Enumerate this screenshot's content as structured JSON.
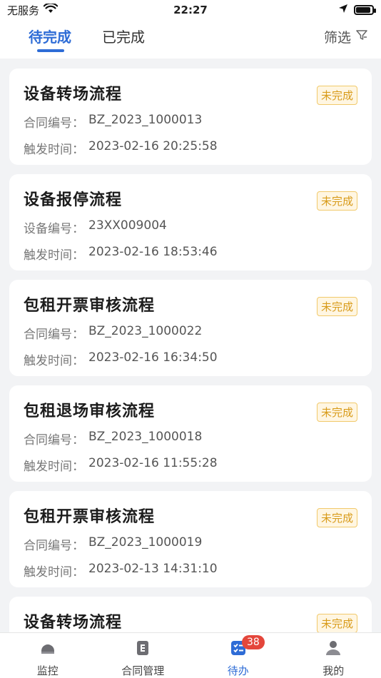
{
  "status_bar": {
    "carrier": "无服务",
    "time": "22:27",
    "battery_level": 0.9
  },
  "tabs": [
    {
      "label": "待完成",
      "active": true
    },
    {
      "label": "已完成",
      "active": false
    }
  ],
  "filter": {
    "label": "筛选",
    "icon": "filter-icon"
  },
  "cards": [
    {
      "title": "设备转场流程",
      "row1_label": "合同编号：",
      "row1_value": "BZ_2023_1000013",
      "row2_label": "触发时间：",
      "row2_value": "2023-02-16 20:25:58",
      "status": "未完成"
    },
    {
      "title": "设备报停流程",
      "row1_label": "设备编号：",
      "row1_value": "23XX009004",
      "row2_label": "触发时间：",
      "row2_value": "2023-02-16 18:53:46",
      "status": "未完成"
    },
    {
      "title": "包租开票审核流程",
      "row1_label": "合同编号：",
      "row1_value": "BZ_2023_1000022",
      "row2_label": "触发时间：",
      "row2_value": "2023-02-16 16:34:50",
      "status": "未完成"
    },
    {
      "title": "包租退场审核流程",
      "row1_label": "合同编号：",
      "row1_value": "BZ_2023_1000018",
      "row2_label": "触发时间：",
      "row2_value": "2023-02-16 11:55:28",
      "status": "未完成"
    },
    {
      "title": "包租开票审核流程",
      "row1_label": "合同编号：",
      "row1_value": "BZ_2023_1000019",
      "row2_label": "触发时间：",
      "row2_value": "2023-02-13 14:31:10",
      "status": "未完成"
    },
    {
      "title": "设备转场流程",
      "row1_label": "",
      "row1_value": "",
      "row2_label": "",
      "row2_value": "",
      "status": "未完成"
    }
  ],
  "bottom_nav": [
    {
      "label": "监控",
      "icon": "monitor-icon",
      "active": false
    },
    {
      "label": "合同管理",
      "icon": "document-icon",
      "active": false
    },
    {
      "label": "待办",
      "icon": "todo-icon",
      "active": true,
      "badge": "38"
    },
    {
      "label": "我的",
      "icon": "user-icon",
      "active": false
    }
  ],
  "colors": {
    "accent": "#2e6cd6",
    "badge_red": "#e4463b",
    "status_orange": "#d89b1a",
    "background": "#f2f3f5"
  }
}
